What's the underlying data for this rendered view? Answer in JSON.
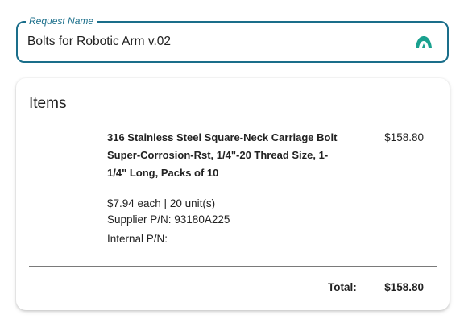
{
  "request_field": {
    "label": "Request Name",
    "value": "Bolts for Robotic Arm v.02",
    "icon": "brand-logo-icon",
    "accent_color": "#1a6e8a",
    "icon_color": "#1aa18f"
  },
  "items_card": {
    "title": "Items",
    "item": {
      "description": "316 Stainless Steel Square-Neck Carriage Bolt Super-Corrosion-Rst, 1/4\"-20 Thread Size, 1-1/4\" Long, Packs of 10",
      "price": "$158.80",
      "unit_line": "$7.94 each | 20 unit(s)",
      "supplier_pn": "Supplier P/N: 93180A225",
      "internal_pn_label": "Internal P/N:",
      "internal_pn_value": ""
    },
    "total_label": "Total:",
    "total_value": "$158.80"
  }
}
